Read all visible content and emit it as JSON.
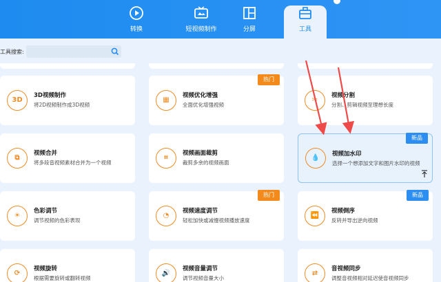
{
  "tabs": [
    {
      "label": "转换",
      "icon": "convert-icon"
    },
    {
      "label": "短视频制作",
      "icon": "tv-icon"
    },
    {
      "label": "分屏",
      "icon": "split-screen-icon"
    },
    {
      "label": "工具",
      "icon": "toolbox-icon",
      "active": true
    }
  ],
  "search": {
    "label": "工具搜索:",
    "placeholder": ""
  },
  "cards": [
    {
      "title": "3D视频制作",
      "desc": "将2D视频制作成3D视频",
      "icon_text": "3D",
      "icon": "3d-icon",
      "badge": ""
    },
    {
      "title": "视频优化增强",
      "desc": "全面优化增强视频",
      "icon_text": "▦",
      "icon": "film-enhance-icon",
      "badge": "热门"
    },
    {
      "title": "视频分割",
      "desc": "分割、剪辑视频至理想长度",
      "icon_text": "✂",
      "icon": "scissors-icon",
      "badge": ""
    },
    {
      "title": "视频合并",
      "desc": "将多段音视频素材合并为一个视频",
      "icon_text": "⧉",
      "icon": "merge-icon",
      "badge": ""
    },
    {
      "title": "视频画面裁剪",
      "desc": "裁剪多余的视频画面",
      "icon_text": "⌗",
      "icon": "crop-icon",
      "badge": ""
    },
    {
      "title": "视频加水印",
      "desc": "选择一个想添加文字和图片水印的视频",
      "icon_text": "💧",
      "icon": "watermark-drop-icon",
      "badge": "新品"
    },
    {
      "title": "色彩调节",
      "desc": "调节视频的色彩表现",
      "icon_text": "☀",
      "icon": "color-adjust-icon",
      "badge": ""
    },
    {
      "title": "视频速度调节",
      "desc": "轻松加快或减慢视频播放速度",
      "icon_text": "◔",
      "icon": "speed-gauge-icon",
      "badge": "热门"
    },
    {
      "title": "视频倒序",
      "desc": "反转并导出逆向视频",
      "icon_text": "⏪",
      "icon": "reverse-icon",
      "badge": "新品"
    },
    {
      "title": "视频旋转",
      "desc": "根据需要旋转或翻转视频",
      "icon_text": "⟳",
      "icon": "rotate-icon",
      "badge": ""
    },
    {
      "title": "视频音量调节",
      "desc": "调节视频音量大小",
      "icon_text": "🔊",
      "icon": "volume-icon",
      "badge": ""
    },
    {
      "title": "音视频同步",
      "desc": "调整音视频相对延迟使音视频同步",
      "icon_text": "⇄",
      "icon": "av-sync-icon",
      "badge": ""
    }
  ],
  "colors": {
    "primary": "#1e8bf0",
    "hot": "#f28a1c",
    "new": "#2d8ef2",
    "arrow": "#ef4a4a"
  }
}
